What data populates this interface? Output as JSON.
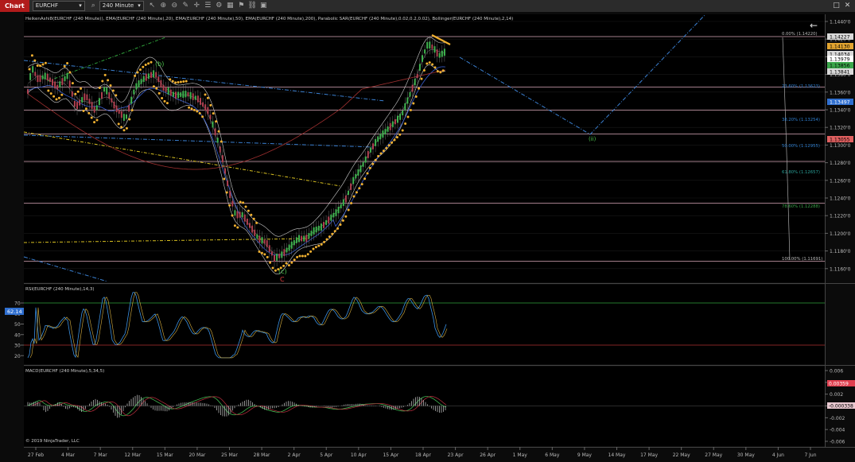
{
  "toolbar": {
    "tab_label": "Chart",
    "instrument": "EURCHF",
    "interval": "240 Minute",
    "icons": [
      "instrument-dropdown-icon",
      "search-icon",
      "interval-dropdown-icon",
      "pointer-icon",
      "zoom-in-icon",
      "zoom-out-icon",
      "drawing-tool-icon",
      "crosshair-icon",
      "properties-icon",
      "strategy-icon",
      "data-box-icon",
      "alert-icon",
      "link-icon",
      "save-icon",
      "close-icon",
      "maximize-icon"
    ]
  },
  "price_panel": {
    "indicators_text": "HeikenAshi8(EURCHF (240 Minute)), EMA(EURCHF (240 Minute),20), EMA(EURCHF (240 Minute),50), EMA(EURCHF (240 Minute),200), Parabolic SAR(EURCHF (240 Minute),0.02,0.2,0.02), Bollinger(EURCHF (240 Minute),2,14)",
    "y_ticks": [
      "1.1440'0",
      "1.1420'0",
      "1.1400'0",
      "1.1380'0",
      "1.1360'0",
      "1.1340'0",
      "1.1320'0",
      "1.1300'0",
      "1.1280'0",
      "1.1260'0",
      "1.1240'0",
      "1.1220'0",
      "1.1200'0",
      "1.1180'0",
      "1.1160'0"
    ],
    "price_tags": [
      {
        "text": "1.14227",
        "bg": "#d9d9d9",
        "fg": "#000"
      },
      {
        "text": "1.14130",
        "bg": "#e3a530",
        "fg": "#000"
      },
      {
        "text": "1.14034",
        "bg": "#d9d9d9",
        "fg": "#000"
      },
      {
        "text": "1.13979",
        "bg": "#ffffff",
        "fg": "#000"
      },
      {
        "text": "1.13856",
        "bg": "#3aa64a",
        "fg": "#000"
      },
      {
        "text": "1.13841",
        "bg": "#d9d9d9",
        "fg": "#000"
      },
      {
        "text": "1.13497",
        "bg": "#2f6fd0",
        "fg": "#fff"
      },
      {
        "text": "1.13055",
        "bg": "#e06060",
        "fg": "#000"
      }
    ],
    "fib_levels": [
      {
        "label": "0.00% (1.14220)",
        "color": "#bbbbbb"
      },
      {
        "label": "23.60% (1.13623)",
        "color": "#2f7fd0"
      },
      {
        "label": "38.20% (1.13254)",
        "color": "#2f7fd0"
      },
      {
        "label": "50.00% (1.12955)",
        "color": "#2f7fd0"
      },
      {
        "label": "61.80% (1.12657)",
        "color": "#2aa198"
      },
      {
        "label": "78.60% (1.12288)",
        "color": "#3aa64a"
      },
      {
        "label": "100.00% (1.11691)",
        "color": "#bbbbbb"
      }
    ],
    "wave_labels": [
      {
        "text": "(b)",
        "color": "#4cc24c"
      },
      {
        "text": "(c)",
        "color": "#4cc24c"
      },
      {
        "text": "C",
        "color": "#e04040"
      },
      {
        "text": "(ii)",
        "color": "#4cc24c"
      }
    ]
  },
  "rsi_panel": {
    "title": "RSI(EURCHF (240 Minute),14,3)",
    "y_ticks": [
      "70",
      "60",
      "50",
      "40",
      "30",
      "20"
    ],
    "value_tag": "62.14",
    "overbought": 70,
    "oversold": 30
  },
  "macd_panel": {
    "title": "MACD(EURCHF (240 Minute),5,34,5)",
    "y_ticks": [
      "0.006",
      "0.004",
      "0.002",
      "0",
      "-0.002",
      "-0.004",
      "-0.006"
    ],
    "value_tags": [
      {
        "text": "0.00359",
        "bg": "#e04050",
        "fg": "#fff"
      },
      {
        "text": "-0.000338",
        "bg": "#e8c8d0",
        "fg": "#000"
      }
    ],
    "copyright": "© 2019 NinjaTrader, LLC"
  },
  "x_axis": {
    "labels": [
      "27 Feb",
      "4 Mar",
      "7 Mar",
      "12 Mar",
      "15 Mar",
      "20 Mar",
      "25 Mar",
      "28 Mar",
      "2 Apr",
      "5 Apr",
      "10 Apr",
      "15 Apr",
      "18 Apr",
      "23 Apr",
      "26 Apr",
      "1 May",
      "6 May",
      "9 May",
      "14 May",
      "17 May",
      "22 May",
      "27 May",
      "30 May",
      "4 Jun",
      "7 Jun"
    ]
  },
  "chart_data": {
    "type": "line",
    "instrument": "EURCHF",
    "timeframe": "240 Minute",
    "title": "",
    "xlabel": "",
    "ylabel": "",
    "ylim": [
      1.1155,
      1.1448
    ],
    "x": [
      "27 Feb",
      "4 Mar",
      "7 Mar",
      "12 Mar",
      "15 Mar",
      "20 Mar",
      "25 Mar",
      "28 Mar",
      "2 Apr",
      "5 Apr",
      "10 Apr",
      "15 Apr",
      "18 Apr"
    ],
    "series": [],
    "fibonacci": [
      1.1422,
      1.13623,
      1.13254,
      1.12955,
      1.12657,
      1.12288,
      1.11691
    ],
    "rsi": {
      "last": 62.14,
      "levels": [
        70,
        30
      ],
      "ylim": [
        15,
        80
      ]
    },
    "macd": {
      "last": 0.00359,
      "hist_last": -0.000338,
      "ylim": [
        -0.007,
        0.007
      ]
    }
  }
}
